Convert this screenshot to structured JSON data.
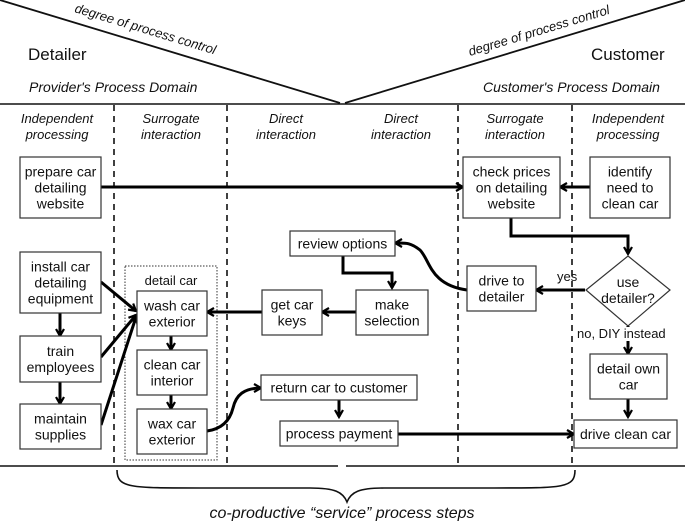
{
  "left_actor": "Detailer",
  "right_actor": "Customer",
  "left_domain": "Provider's Process Domain",
  "right_domain": "Customer's Process Domain",
  "control_label": "degree of process control",
  "columns": [
    {
      "l1": "Independent",
      "l2": "processing"
    },
    {
      "l1": "Surrogate",
      "l2": "interaction"
    },
    {
      "l1": "Direct",
      "l2": "interaction"
    },
    {
      "l1": "Direct",
      "l2": "interaction"
    },
    {
      "l1": "Surrogate",
      "l2": "interaction"
    },
    {
      "l1": "Independent",
      "l2": "processing"
    }
  ],
  "group_label": "detail car",
  "nodes": {
    "prepare": [
      "prepare car",
      "detailing",
      "website"
    ],
    "check": [
      "check prices",
      "on detailing",
      "website"
    ],
    "identify": [
      "identify",
      "need to",
      "clean car"
    ],
    "review": [
      "review options"
    ],
    "install": [
      "install car",
      "detailing",
      "equipment"
    ],
    "wash": [
      "wash car",
      "exterior"
    ],
    "getkeys": [
      "get car",
      "keys"
    ],
    "select": [
      "make",
      "selection"
    ],
    "drive": [
      "drive to",
      "detailer"
    ],
    "decision": [
      "use",
      "detailer?"
    ],
    "train": [
      "train",
      "employees"
    ],
    "clean": [
      "clean car",
      "interior"
    ],
    "return": [
      "return car to customer"
    ],
    "detailown": [
      "detail own",
      "car"
    ],
    "maintain": [
      "maintain",
      "supplies"
    ],
    "wax": [
      "wax car",
      "exterior"
    ],
    "payment": [
      "process payment"
    ],
    "driveclean": [
      "drive clean car"
    ]
  },
  "edge_labels": {
    "yes": "yes",
    "no": "no, DIY instead"
  },
  "footer": "co-productive “service” process steps"
}
